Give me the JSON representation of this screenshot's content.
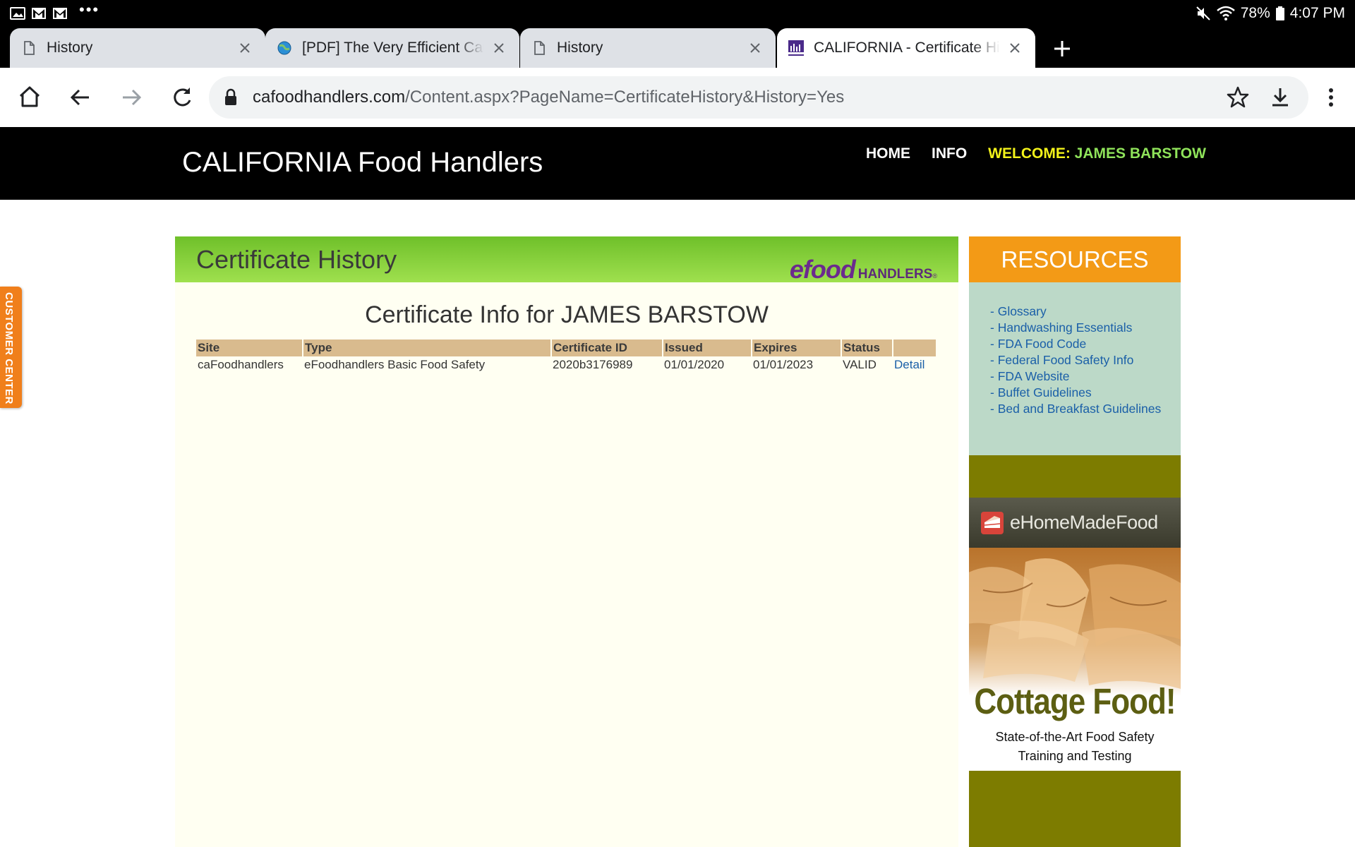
{
  "status_bar": {
    "battery": "78%",
    "time": "4:07 PM",
    "more": "•••"
  },
  "tabs": [
    {
      "title": "History",
      "active": false
    },
    {
      "title": "[PDF] The Very Efficient Carpenter",
      "active": false
    },
    {
      "title": "History",
      "active": false
    },
    {
      "title": "CALIFORNIA - Certificate History",
      "active": true
    }
  ],
  "address_bar": {
    "host": "cafoodhandlers.com",
    "path": "/Content.aspx?PageName=CertificateHistory&History=Yes"
  },
  "site": {
    "title": "CALIFORNIA Food Handlers",
    "nav": {
      "home": "HOME",
      "info": "INFO",
      "welcome_label": "WELCOME:",
      "welcome_name": "JAMES BARSTOW"
    }
  },
  "main": {
    "banner_title": "Certificate History",
    "brand_efood": "efood",
    "brand_handlers": "HANDLERS",
    "brand_reg": "®",
    "heading": "Certificate Info for JAMES BARSTOW",
    "table": {
      "headers": [
        "Site",
        "Type",
        "Certificate ID",
        "Issued",
        "Expires",
        "Status",
        ""
      ],
      "rows": [
        {
          "site": "caFoodhandlers",
          "type": "eFoodhandlers Basic Food Safety",
          "certificate_id": "2020b3176989",
          "issued": "01/01/2020",
          "expires": "01/01/2023",
          "status": "VALID",
          "action": "Detail"
        }
      ]
    }
  },
  "resources": {
    "title": "RESOURCES",
    "dash": "- ",
    "items": [
      "Glossary",
      "Handwashing Essentials",
      "FDA Food Code",
      "Federal Food Safety Info",
      "FDA Website",
      "Buffet Guidelines",
      "Bed and Breakfast Guidelines"
    ]
  },
  "ad": {
    "brand": "eHomeMadeFood",
    "headline": "Cottage Food!",
    "sub_line1": "State-of-the-Art Food Safety",
    "sub_line2": "Training and Testing"
  },
  "customer_center": "CUSTOMER CENTER",
  "colors": {
    "site_header_bg": "#000000",
    "banner_green": "#7ccf34",
    "table_header": "#d9bb8e",
    "resources_orange": "#f39a16",
    "resources_bg": "#bcd9c8",
    "ad_olive": "#7d7c00",
    "link_blue": "#1a5fa8",
    "customer_orange": "#f07f1b"
  }
}
